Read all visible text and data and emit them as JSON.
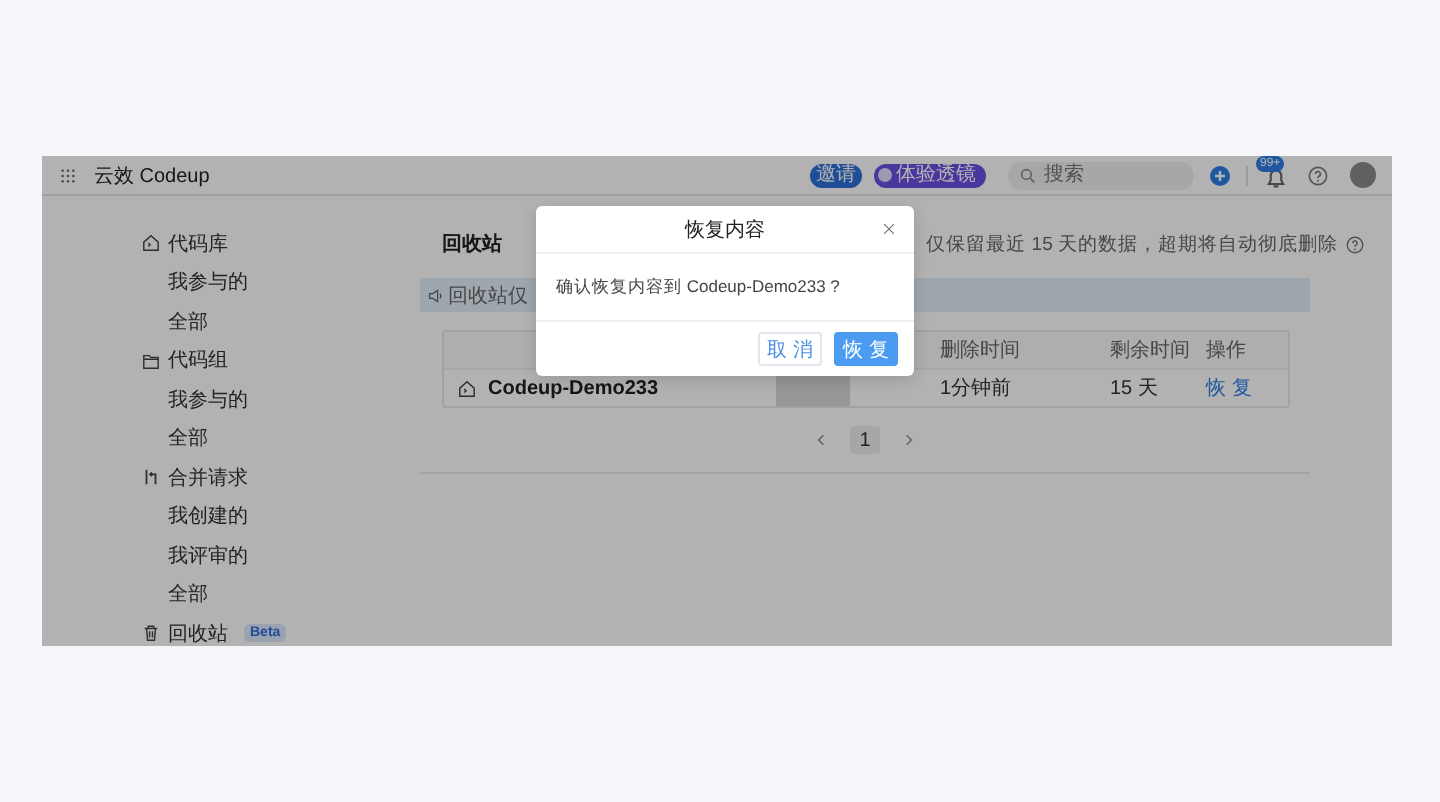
{
  "header": {
    "logo_text": "云效 Codeup",
    "invite_button": "邀请",
    "trial_button": "体验透镜",
    "search": {
      "placeholder": "搜索"
    },
    "notification_badge": "99+"
  },
  "sidebar": {
    "groups": [
      {
        "label": "代码库",
        "children": [
          {
            "label": "我参与的"
          },
          {
            "label": "全部"
          }
        ]
      },
      {
        "label": "代码组",
        "children": [
          {
            "label": "我参与的"
          },
          {
            "label": "全部"
          }
        ]
      },
      {
        "label": "合并请求",
        "children": [
          {
            "label": "我创建的"
          },
          {
            "label": "我评审的"
          },
          {
            "label": "全部"
          }
        ]
      },
      {
        "label": "回收站",
        "badge": "Beta"
      }
    ]
  },
  "content": {
    "title": "回收站",
    "retention_note": "仅保留最近 15 天的数据，超期将自动彻底删除",
    "notice": "回收站仅",
    "table": {
      "columns": [
        {
          "label": "删除时间"
        },
        {
          "label": "剩余时间"
        },
        {
          "label": "操作"
        }
      ],
      "rows": [
        {
          "name": "Codeup-Demo233",
          "delete_time": "1分钟前",
          "remaining": "15 天",
          "action": "恢 复"
        }
      ]
    },
    "pagination": [
      {
        "label": "1",
        "selected": true
      }
    ]
  },
  "modal": {
    "title": "恢复内容",
    "message": "确认恢复内容到 Codeup-Demo233 ?",
    "cancel_button": "取 消",
    "confirm_button": "恢 复"
  }
}
